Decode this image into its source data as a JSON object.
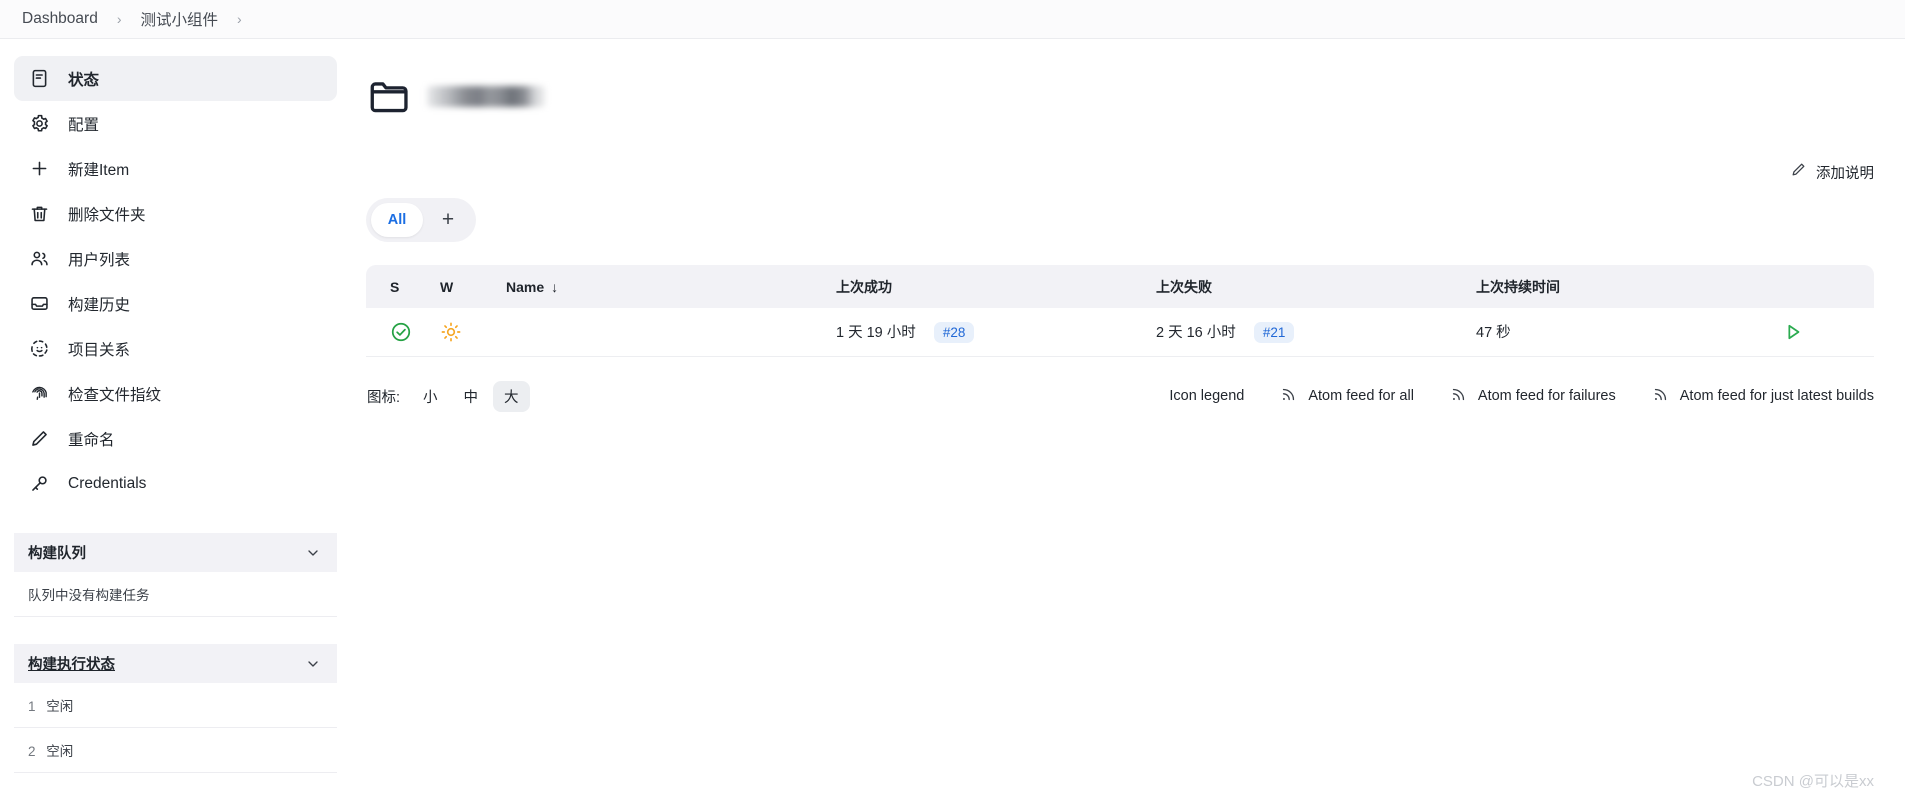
{
  "breadcrumb": {
    "items": [
      {
        "label": "Dashboard"
      },
      {
        "label": "测试小组件"
      }
    ],
    "separator": "›"
  },
  "sidebar": {
    "items": [
      {
        "label": "状态",
        "icon": "document-icon",
        "active": true
      },
      {
        "label": "配置",
        "icon": "gear-icon",
        "active": false
      },
      {
        "label": "新建Item",
        "icon": "plus-icon",
        "active": false
      },
      {
        "label": "删除文件夹",
        "icon": "trash-icon",
        "active": false
      },
      {
        "label": "用户列表",
        "icon": "users-icon",
        "active": false
      },
      {
        "label": "构建历史",
        "icon": "inbox-icon",
        "active": false
      },
      {
        "label": "项目关系",
        "icon": "relations-icon",
        "active": false
      },
      {
        "label": "检查文件指纹",
        "icon": "fingerprint-icon",
        "active": false
      },
      {
        "label": "重命名",
        "icon": "pencil-icon",
        "active": false
      },
      {
        "label": "Credentials",
        "icon": "key-icon",
        "active": false
      }
    ],
    "build_queue": {
      "title": "构建队列",
      "empty_text": "队列中没有构建任务"
    },
    "executor_status": {
      "title": "构建执行状态",
      "executors": [
        {
          "number": "1",
          "state": "空闲"
        },
        {
          "number": "2",
          "state": "空闲"
        }
      ]
    }
  },
  "main": {
    "folder_icon": "folder-icon",
    "title_redacted": true,
    "add_description": {
      "label": "添加说明",
      "icon": "pencil-icon"
    },
    "tabs": [
      {
        "label": "All",
        "active": true
      },
      {
        "label": "+",
        "active": false
      }
    ],
    "table": {
      "columns": [
        {
          "key": "s",
          "label": "S"
        },
        {
          "key": "w",
          "label": "W"
        },
        {
          "key": "name",
          "label": "Name",
          "sort": "↓"
        },
        {
          "key": "last_success",
          "label": "上次成功"
        },
        {
          "key": "last_failure",
          "label": "上次失败"
        },
        {
          "key": "last_duration",
          "label": "上次持续时间"
        }
      ],
      "rows": [
        {
          "status_icon": "success-check-icon",
          "weather_icon": "sunny-icon",
          "name_redacted": true,
          "last_success_time": "1 天 19 小时",
          "last_success_build": "#28",
          "last_failure_time": "2 天 16 小时",
          "last_failure_build": "#21",
          "last_duration": "47 秒",
          "action_icon": "build-now-play-icon"
        }
      ]
    },
    "icon_size": {
      "label": "图标:",
      "options": [
        {
          "label": "小",
          "active": false
        },
        {
          "label": "中",
          "active": false
        },
        {
          "label": "大",
          "active": true
        }
      ]
    },
    "footer_links": [
      {
        "label": "Icon legend",
        "icon": null
      },
      {
        "label": "Atom feed for all",
        "icon": "rss-icon"
      },
      {
        "label": "Atom feed for failures",
        "icon": "rss-icon"
      },
      {
        "label": "Atom feed for just latest builds",
        "icon": "rss-icon"
      }
    ]
  },
  "watermark": "CSDN @可以是xx",
  "colors": {
    "accent_blue": "#1b6ee3",
    "success_green": "#2bab50",
    "weather_orange": "#f6a623",
    "panel_gray": "#f2f2f6"
  }
}
